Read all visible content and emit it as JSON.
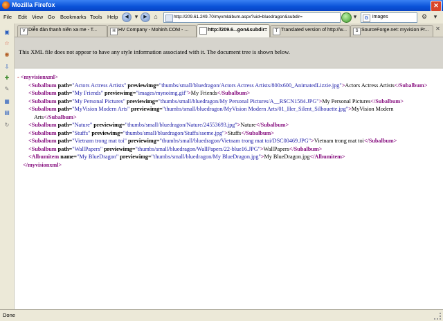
{
  "window": {
    "title": "Mozilla Firefox"
  },
  "menu": [
    "File",
    "Edit",
    "View",
    "Go",
    "Bookmarks",
    "Tools",
    "Help"
  ],
  "url": "http://209.61.249.70/myxmlalbum.aspx?uid=bluedragon&subdir=",
  "search_value": "images",
  "tabs": [
    {
      "label": "Diễn đàn thanh niên xa me - T...",
      "favicon": "V"
    },
    {
      "label": "HV Company - Mohinh.COM - ...",
      "favicon": "H"
    },
    {
      "label": "http://209.6...gon&subdir=",
      "favicon": "",
      "active": true
    },
    {
      "label": "Translated version of http://w...",
      "favicon": "T"
    },
    {
      "label": "SourceForge.net: myvision Pr...",
      "favicon": "S"
    }
  ],
  "info_message": "This XML file does not appear to have any style information associated with it. The document tree is shown below.",
  "xml": {
    "minus": "-",
    "root_open": "<myvisionxml>",
    "root_close": "</myvisionxml>",
    "sub_open": "<Subalbum",
    "sub_close": "</Subalbum>",
    "item_open": "<Albumitem",
    "item_close": "</Albumitem>",
    "path_attr": "path=",
    "name_attr": "name=",
    "prev_attr": "previewimg=",
    "subalbums": [
      {
        "path": "\"Actors Actress Artists\"",
        "preview": "\"thumbs/small/bluedragon/Actors Actress Artists/800x600_AnimatedLizzie.jpg\"",
        "text": "Actors Actress Artists"
      },
      {
        "path": "\"My Friends\"",
        "preview": "\"images/mynoimg.gif\"",
        "text": "My Friends"
      },
      {
        "path": "\"My Personal Pictures\"",
        "preview": "\"thumbs/small/bluedragon/My Personal Pictures/A__RSCN1584.JPG\"",
        "text": "My Personal Pictures"
      },
      {
        "path": "\"MyVision Modern Arts\"",
        "preview": "\"thumbs/small/bluedragon/MyVision Modern Arts/01_Her_Silent_Silhouette.jpg\"",
        "text": "MyVision Modern Arts"
      },
      {
        "path": "\"Nature\"",
        "preview": "\"thumbs/small/bluedragon/Nature/24553693.jpg\"",
        "text": "Nature"
      },
      {
        "path": "\"Stuffs\"",
        "preview": "\"thumbs/small/bluedragon/Stuffs/sseme.jpg\"",
        "text": "Stuffs"
      },
      {
        "path": "\"Vietnam trong mat toi\"",
        "preview": "\"thumbs/small/bluedragon/Vietnam trong mat toi/DSC00469.JPG\"",
        "text": "Vietnam trong mat toi"
      },
      {
        "path": "\"WallPapers\"",
        "preview": "\"thumbs/small/bluedragon/WallPapers/22-blue16.JPG\"",
        "text": "WallPapers"
      }
    ],
    "albumitem": {
      "name": "\"My BlueDragon\"",
      "preview": "\"thumbs/small/bluedragon/My BlueDragon.jpg\"",
      "text": "My BlueDragon.jpg"
    }
  },
  "status": "Done"
}
